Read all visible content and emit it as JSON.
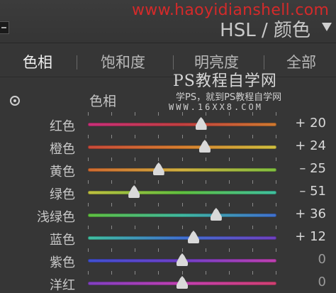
{
  "watermark_top": "www.haoyidianshell.com",
  "panel": {
    "title": "HSL / 颜色"
  },
  "tabs": [
    {
      "label": "色相",
      "active": true
    },
    {
      "label": "饱和度",
      "active": false
    },
    {
      "label": "明亮度",
      "active": false
    },
    {
      "label": "全部",
      "active": false
    }
  ],
  "section": {
    "label": "色相",
    "icon": "target-adjust-icon"
  },
  "watermark": {
    "title": "PS教程自学网",
    "subtitle": "学PS，就到PS教程自学网",
    "url": "WWW.16XX8.COM"
  },
  "sliders": [
    {
      "label": "红色",
      "value": 20,
      "display": "+ 20",
      "gradient": [
        "#c8307a",
        "#c04040",
        "#d07a30"
      ]
    },
    {
      "label": "橙色",
      "value": 24,
      "display": "+ 24",
      "gradient": [
        "#c84a3a",
        "#d88030",
        "#d0c040"
      ]
    },
    {
      "label": "黄色",
      "value": -25,
      "display": "– 25",
      "gradient": [
        "#d06a30",
        "#d0b040",
        "#80c040"
      ]
    },
    {
      "label": "绿色",
      "value": -51,
      "display": "– 51",
      "gradient": [
        "#c0c040",
        "#60c040",
        "#40c0a0"
      ]
    },
    {
      "label": "浅绿色",
      "value": 36,
      "display": "+ 36",
      "gradient": [
        "#60c040",
        "#40b8a0",
        "#4070d0"
      ]
    },
    {
      "label": "蓝色",
      "value": 12,
      "display": "+ 12",
      "gradient": [
        "#40c0a0",
        "#4070d0",
        "#7040c0"
      ]
    },
    {
      "label": "紫色",
      "value": 0,
      "display": "0",
      "gradient": [
        "#4050d0",
        "#7040c8",
        "#c040b0"
      ]
    },
    {
      "label": "洋红",
      "value": 0,
      "display": "0",
      "gradient": [
        "#8040c0",
        "#c040b0",
        "#d04070"
      ]
    }
  ]
}
